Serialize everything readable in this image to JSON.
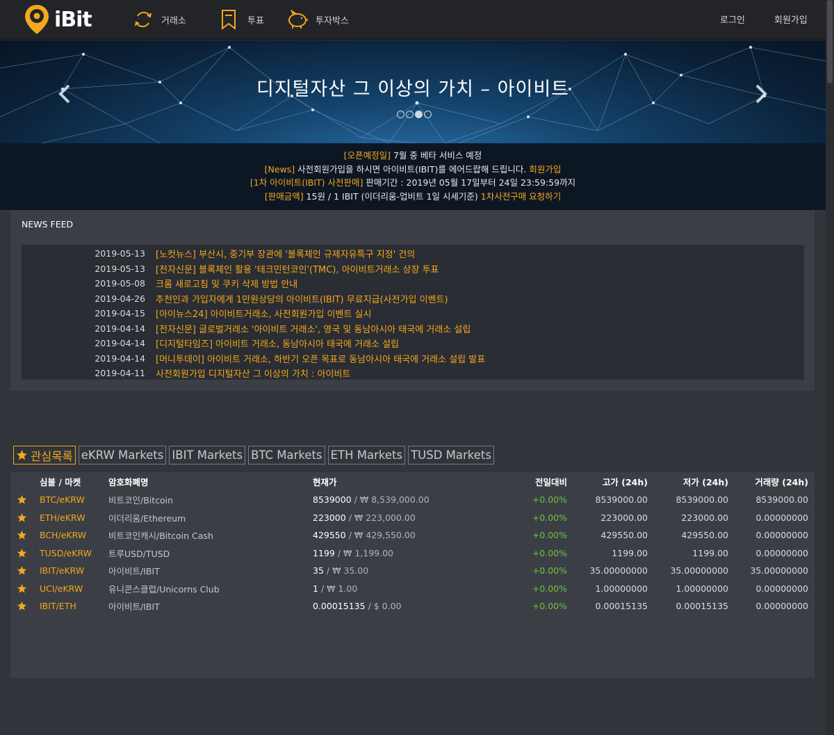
{
  "header": {
    "logo_text": "iBit",
    "nav": [
      {
        "label": "거래소",
        "icon": "exchange-icon"
      },
      {
        "label": "투표",
        "icon": "vote-bookmark-icon"
      },
      {
        "label": "투자박스",
        "icon": "piggy-bank-icon"
      }
    ],
    "login": "로그인",
    "signup": "회원가입"
  },
  "banner": {
    "title": "디지털자산 그 이상의 가치 – 아이비트",
    "slides": 4,
    "active_slide": 3
  },
  "notice": [
    {
      "tag": "[오픈예정일]",
      "text": " 7월 중 베타 서비스 예정",
      "link": ""
    },
    {
      "tag": "[News]",
      "text": " 사전회원가입을 하시면 아이비트(IBIT)를 에어드랍해 드립니다. ",
      "link": "회원가입"
    },
    {
      "tag": "[1차 아이비트(IBIT) 사전판매]",
      "text": " 판매기간 : 2019년 05월 17일부터 24일 23:59:59까지",
      "link": ""
    },
    {
      "tag": "[판매금액]",
      "text": " 15원 / 1 IBIT (이더리움-업비트 1일 시세기준) ",
      "link": "1차사전구매 요청하기"
    }
  ],
  "news": {
    "title": "NEWS FEED",
    "items": [
      {
        "date": "2019-05-13",
        "title": "[노컷뉴스] 부산시, 중기부 장관에 '블록체인 규제자유특구 지정' 건의"
      },
      {
        "date": "2019-05-13",
        "title": "[전자신문] 블록체인 활용 '테크민턴코인'(TMC), 아이비트거래소 상장 투표"
      },
      {
        "date": "2019-05-08",
        "title": "크롬 새로고침 및 쿠키 삭제 방법 안내"
      },
      {
        "date": "2019-04-26",
        "title": "추천인과 가입자에게 1만원상당의 아이비트(IBIT) 무료지급(사전가입 이벤트)"
      },
      {
        "date": "2019-04-15",
        "title": "[아이뉴스24] 아이비트거래소, 사전회원가입 이벤트 실시"
      },
      {
        "date": "2019-04-14",
        "title": "[전자신문] 글로벌거래소 '아이비트 거래소', 영국 및 동남아시아 태국에 거래소 설립"
      },
      {
        "date": "2019-04-14",
        "title": "[디지털타임즈] 아이비트 거래소, 동남아시아 태국에 거래소 설립"
      },
      {
        "date": "2019-04-14",
        "title": "[머니투데이] 아이비트 거래소, 하반기 오픈 목표로 동남아시아 태국에 거래소 설립 발표"
      },
      {
        "date": "2019-04-11",
        "title": "사전회원가입 디지털자산 그 이상의 가치 : 아이비트"
      }
    ]
  },
  "markets": {
    "tabs": [
      "관심목록",
      "eKRW Markets",
      "IBIT Markets",
      "BTC Markets",
      "ETH Markets",
      "TUSD Markets"
    ],
    "active_tab": 0,
    "columns": [
      "심볼 / 마켓",
      "암호화폐명",
      "현재가",
      "전일대비",
      "고가 (24h)",
      "저가 (24h)",
      "거래량 (24h)"
    ],
    "rows": [
      {
        "symbol": "BTC/eKRW",
        "name": "비트코인/Bitcoin",
        "price": "8539000",
        "krw": "/ ₩ 8,539,000.00",
        "change": "+0.00%",
        "high": "8539000.00",
        "low": "8539000.00",
        "volume": "8539000.00"
      },
      {
        "symbol": "ETH/eKRW",
        "name": "이더리움/Ethereum",
        "price": "223000",
        "krw": "/ ₩ 223,000.00",
        "change": "+0.00%",
        "high": "223000.00",
        "low": "223000.00",
        "volume": "0.00000000"
      },
      {
        "symbol": "BCH/eKRW",
        "name": "비트코인캐시/Bitcoin Cash",
        "price": "429550",
        "krw": "/ ₩ 429,550.00",
        "change": "+0.00%",
        "high": "429550.00",
        "low": "429550.00",
        "volume": "0.00000000"
      },
      {
        "symbol": "TUSD/eKRW",
        "name": "트루USD/TUSD",
        "price": "1199",
        "krw": "/ ₩ 1,199.00",
        "change": "+0.00%",
        "high": "1199.00",
        "low": "1199.00",
        "volume": "0.00000000"
      },
      {
        "symbol": "IBIT/eKRW",
        "name": "아이비트/IBIT",
        "price": "35",
        "krw": "/ ₩ 35.00",
        "change": "+0.00%",
        "high": "35.00000000",
        "low": "35.00000000",
        "volume": "35.00000000"
      },
      {
        "symbol": "UCI/eKRW",
        "name": "유니콘스클럽/Unicorns Club",
        "price": "1",
        "krw": "/ ₩ 1.00",
        "change": "+0.00%",
        "high": "1.00000000",
        "low": "1.00000000",
        "volume": "0.00000000"
      },
      {
        "symbol": "IBIT/ETH",
        "name": "아이비트/IBIT",
        "price": "0.00015135",
        "krw": "/ $ 0.00",
        "change": "+0.00%",
        "high": "0.00015135",
        "low": "0.00015135",
        "volume": "0.00000000"
      }
    ]
  },
  "colors": {
    "accent": "#f4a81c",
    "positive": "#6dc241",
    "header_bg": "#222428",
    "page_bg": "#31343b"
  }
}
